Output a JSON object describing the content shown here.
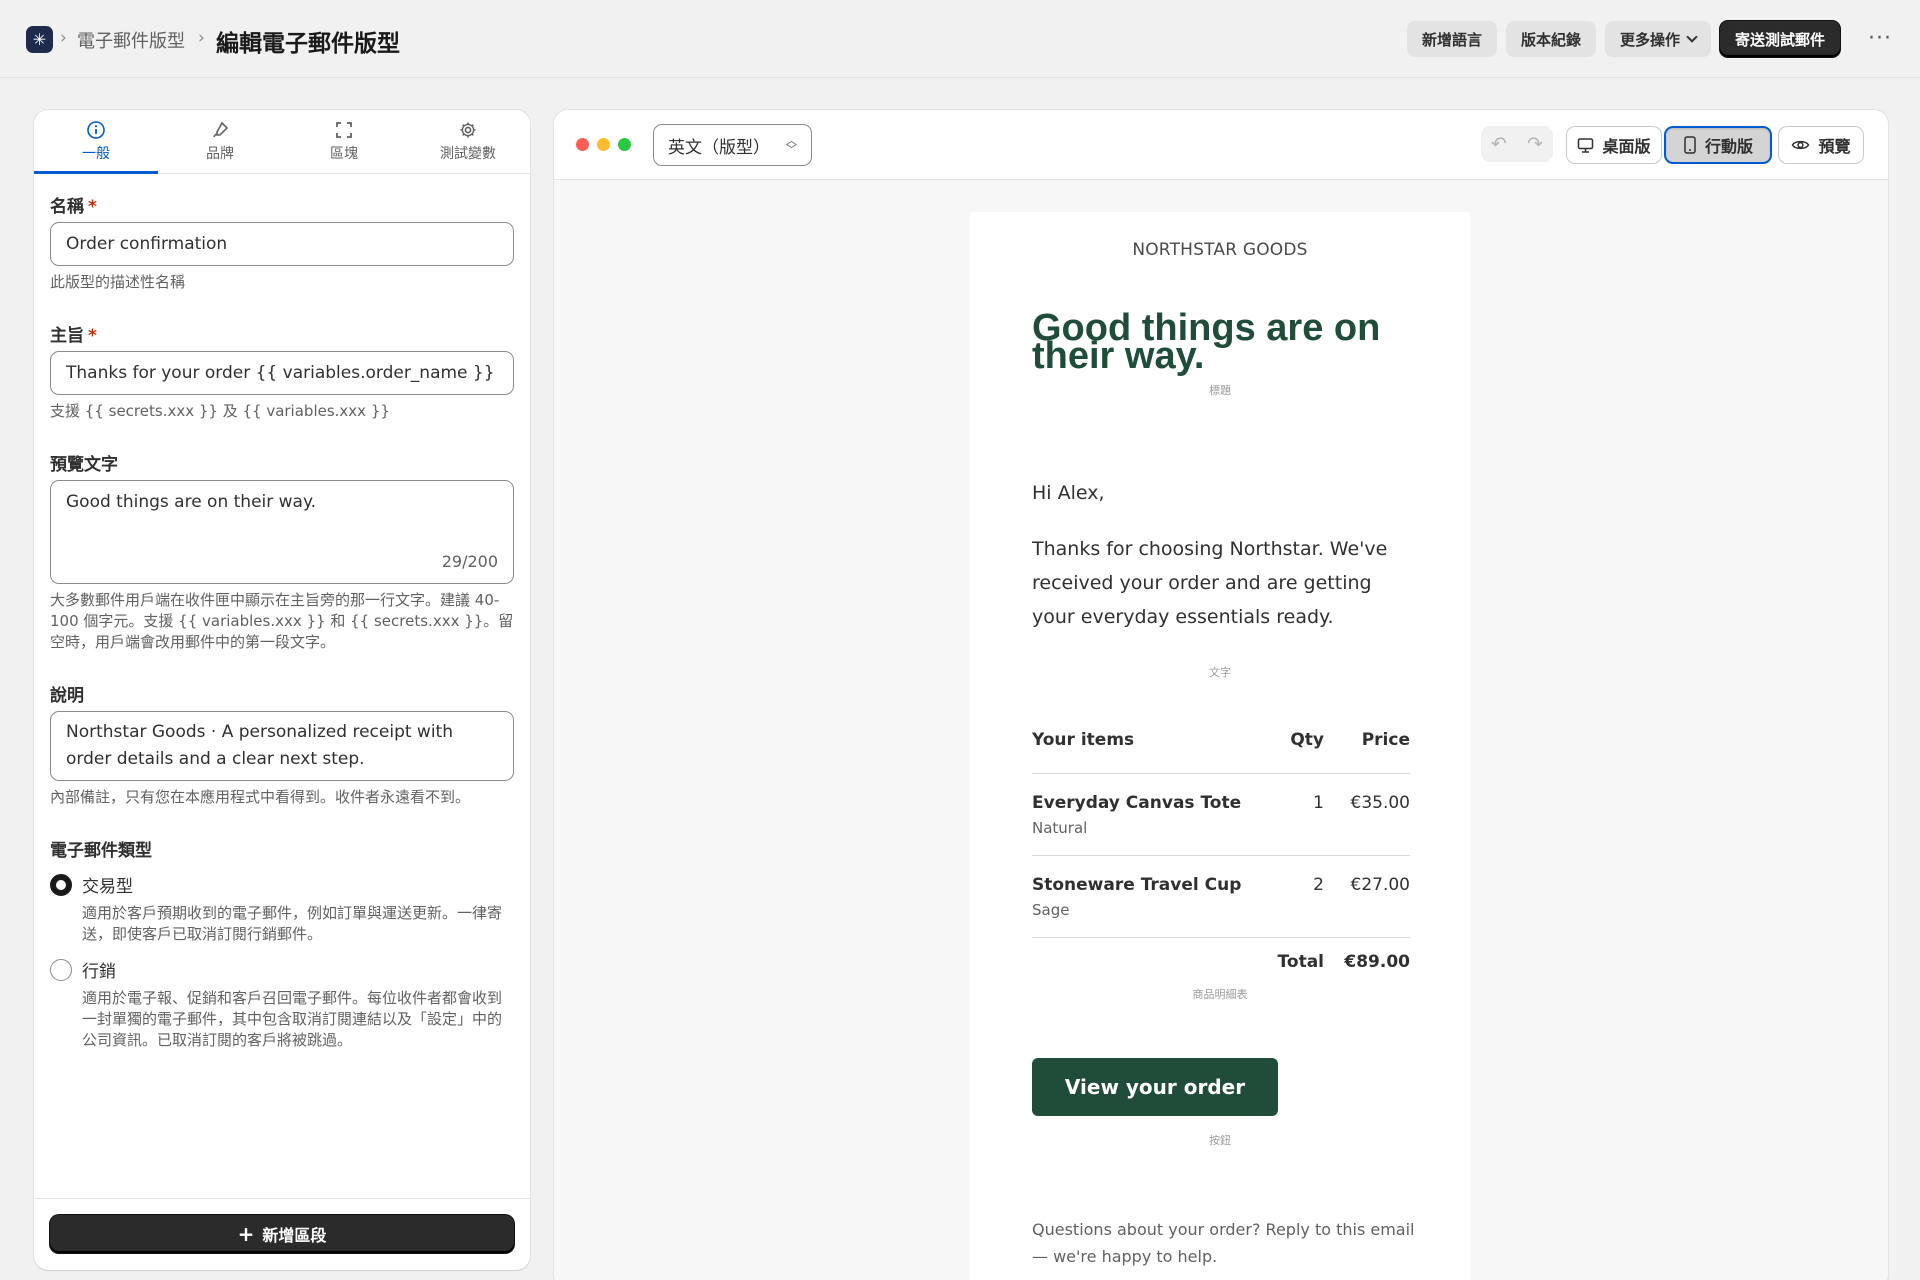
{
  "header": {
    "breadcrumb_parent": "電子郵件版型",
    "title": "編輯電子郵件版型",
    "actions": {
      "add_language": "新增語言",
      "version_history": "版本紀錄",
      "more_actions": "更多操作",
      "send_test": "寄送測試郵件"
    },
    "more_icon": "more-horizontal-icon",
    "logo_icon": "app-logo-icon"
  },
  "tabs": [
    {
      "label": "一般",
      "icon": "info-icon",
      "active": true
    },
    {
      "label": "品牌",
      "icon": "brush-icon",
      "active": false
    },
    {
      "label": "區塊",
      "icon": "frame-icon",
      "active": false
    },
    {
      "label": "測試變數",
      "icon": "gear-icon",
      "active": false
    }
  ],
  "form": {
    "name": {
      "label": "名稱",
      "required": "*",
      "value": "Order confirmation",
      "help": "此版型的描述性名稱"
    },
    "subject": {
      "label": "主旨",
      "required": "*",
      "value": "Thanks for your order {{ variables.order_name }}",
      "help": "支援 {{ secrets.xxx }} 及 {{ variables.xxx }}"
    },
    "preview_text": {
      "label": "預覽文字",
      "value": "Good things are on their way.",
      "counter": "29/200",
      "help": "大多數郵件用戶端在收件匣中顯示在主旨旁的那一行文字。建議 40-100 個字元。支援 {{ variables.xxx }} 和 {{ secrets.xxx }}。留空時，用戶端會改用郵件中的第一段文字。"
    },
    "description": {
      "label": "說明",
      "value": "Northstar Goods · A personalized receipt with order details and a clear next step.",
      "help": "內部備註，只有您在本應用程式中看得到。收件者永遠看不到。"
    },
    "email_type": {
      "label": "電子郵件類型",
      "options": [
        {
          "label": "交易型",
          "selected": true,
          "help": "適用於客戶預期收到的電子郵件，例如訂單與運送更新。一律寄送，即使客戶已取消訂閱行銷郵件。"
        },
        {
          "label": "行銷",
          "selected": false,
          "help": "適用於電子報、促銷和客戶召回電子郵件。每位收件者都會收到一封單獨的電子郵件，其中包含取消訂閱連結以及「設定」中的公司資訊。已取消訂閱的客戶將被跳過。"
        }
      ]
    },
    "add_section": "新增區段"
  },
  "preview": {
    "language": "英文（版型）",
    "view_desktop": "桌面版",
    "view_mobile": "行動版",
    "preview": "預覽",
    "active_view": "mobile",
    "window_dots": [
      "#ff5f57",
      "#febc2e",
      "#28c840"
    ]
  },
  "email": {
    "brand": "NORTHSTAR GOODS",
    "headline": "Good things are on their way.",
    "tag_heading": "標題",
    "greeting": "Hi Alex,",
    "body": "Thanks for choosing Northstar. We've received your order and are getting your everyday essentials ready.",
    "tag_text": "文字",
    "items_header": {
      "name": "Your items",
      "qty": "Qty",
      "price": "Price"
    },
    "items": [
      {
        "name": "Everyday Canvas Tote",
        "variant": "Natural",
        "qty": "1",
        "price": "€35.00"
      },
      {
        "name": "Stoneware Travel Cup",
        "variant": "Sage",
        "qty": "2",
        "price": "€27.00"
      }
    ],
    "total_label": "Total",
    "total_value": "€89.00",
    "tag_items": "商品明細表",
    "cta": "View your order",
    "tag_button": "按鈕",
    "footer": "Questions about your order? Reply to this email — we're happy to help."
  },
  "colors": {
    "accent": "#005bd3",
    "brand_green": "#1f4d3a",
    "primary_button": "#2b2b2b"
  }
}
